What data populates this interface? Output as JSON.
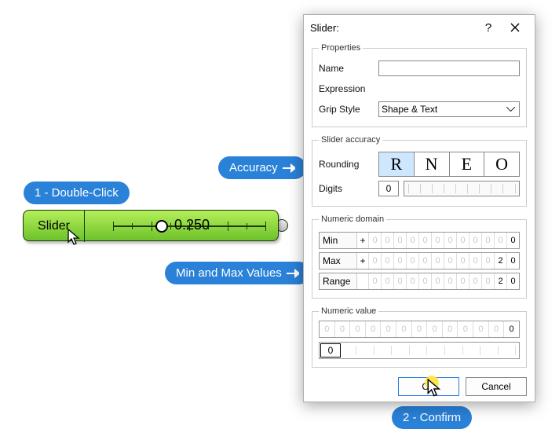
{
  "annotations": {
    "doubleClick": "1 - Double-Click",
    "accuracy": "Accuracy",
    "minmax": "Min and Max Values",
    "confirm": "2 - Confirm"
  },
  "slider": {
    "label": "Slider",
    "value": "0.250"
  },
  "dialog": {
    "title": "Slider:",
    "properties": {
      "legend": "Properties",
      "nameLabel": "Name",
      "nameValue": "",
      "exprLabel": "Expression",
      "gripLabel": "Grip Style",
      "gripValue": "Shape & Text"
    },
    "accuracy": {
      "legend": "Slider accuracy",
      "roundingLabel": "Rounding",
      "modes": {
        "r": "R",
        "n": "N",
        "e": "E",
        "o": "O"
      },
      "digitsLabel": "Digits",
      "digitsValue": "0"
    },
    "domain": {
      "legend": "Numeric domain",
      "minLabel": "Min",
      "minSign": "+",
      "minVal": "0",
      "maxLabel": "Max",
      "maxSign": "+",
      "maxVal": "2 0",
      "rangeLabel": "Range",
      "rangeVal": "2 0"
    },
    "value": {
      "legend": "Numeric value",
      "displayVal": "0",
      "current": "0"
    },
    "buttons": {
      "ok": "OK",
      "cancel": "Cancel"
    }
  }
}
